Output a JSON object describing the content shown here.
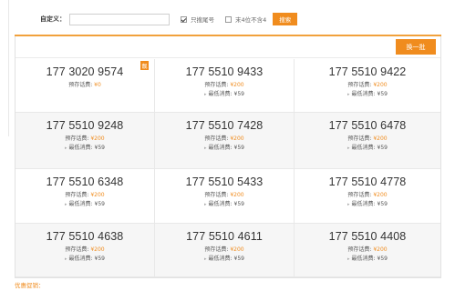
{
  "search": {
    "label": "自定义：",
    "input_value": "",
    "option1_label": "只搜尾号",
    "option1_checked": true,
    "option2_label": "末4位不含4",
    "option2_checked": false,
    "button_label": "搜索"
  },
  "panel": {
    "swap_label": "换一批",
    "accent_color": "#f08c1e"
  },
  "numbers": [
    {
      "number": "177 3020 9574",
      "prestore_label": "预存话费:",
      "prestore_value": "¥0",
      "min_label": "",
      "min_value": "",
      "badge": "靓"
    },
    {
      "number": "177 5510 9433",
      "prestore_label": "预存话费:",
      "prestore_value": "¥200",
      "min_label": "最低消费:",
      "min_value": "¥59",
      "badge": ""
    },
    {
      "number": "177 5510 9422",
      "prestore_label": "预存话费:",
      "prestore_value": "¥200",
      "min_label": "最低消费:",
      "min_value": "¥59",
      "badge": ""
    },
    {
      "number": "177 5510 9248",
      "prestore_label": "预存话费:",
      "prestore_value": "¥200",
      "min_label": "最低消费:",
      "min_value": "¥59",
      "badge": ""
    },
    {
      "number": "177 5510 7428",
      "prestore_label": "预存话费:",
      "prestore_value": "¥200",
      "min_label": "最低消费:",
      "min_value": "¥59",
      "badge": ""
    },
    {
      "number": "177 5510 6478",
      "prestore_label": "预存话费:",
      "prestore_value": "¥200",
      "min_label": "最低消费:",
      "min_value": "¥59",
      "badge": ""
    },
    {
      "number": "177 5510 6348",
      "prestore_label": "预存话费:",
      "prestore_value": "¥200",
      "min_label": "最低消费:",
      "min_value": "¥59",
      "badge": ""
    },
    {
      "number": "177 5510 5433",
      "prestore_label": "预存话费:",
      "prestore_value": "¥200",
      "min_label": "最低消费:",
      "min_value": "¥59",
      "badge": ""
    },
    {
      "number": "177 5510 4778",
      "prestore_label": "预存话费:",
      "prestore_value": "¥200",
      "min_label": "最低消费:",
      "min_value": "¥59",
      "badge": ""
    },
    {
      "number": "177 5510 4638",
      "prestore_label": "预存话费:",
      "prestore_value": "¥200",
      "min_label": "最低消费:",
      "min_value": "¥59",
      "badge": ""
    },
    {
      "number": "177 5510 4611",
      "prestore_label": "预存话费:",
      "prestore_value": "¥200",
      "min_label": "最低消费:",
      "min_value": "¥59",
      "badge": ""
    },
    {
      "number": "177 5510 4408",
      "prestore_label": "预存话费:",
      "prestore_value": "¥200",
      "min_label": "最低消费:",
      "min_value": "¥59",
      "badge": ""
    }
  ],
  "footer": {
    "note": "优惠促销："
  }
}
